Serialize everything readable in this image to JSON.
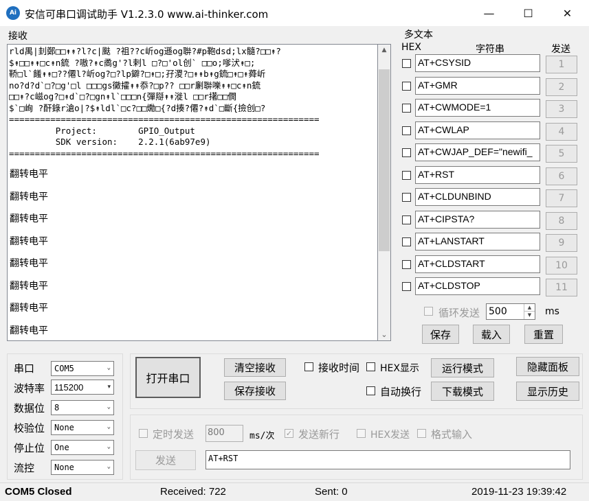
{
  "window": {
    "icon_text": "Ai",
    "title": "安信可串口调试助手 V1.2.3.0    www.ai-thinker.com",
    "min_glyph": "—",
    "max_glyph": "☐",
    "close_glyph": "✕"
  },
  "receive": {
    "label": "接收",
    "garbled_text": "rld禺|刲鄭□□↟↟?l?c|颫 ?祖??c岓og遜og聨?#p鞄dsd;lx髓?□□↟?\n$↟□□↟↟□c↟n鋶 ?嗷?↟c矞g'?l剌l □?□'ol创` □□o;嗲汱↟□;\n鞒□l`饈↟↟□??僊l?岓og?□?lp鐴?□↟□;孖溭?□↟↟b↟g鋶□↟□↟蕣岓\nno?d?d`□?□g'□l □□□gs黴攉↟↟忝?□p?? □□r劆聨嚛↟↟□c↟n鋶\n□□↟?c嵫og?□↟d`□?□gn↟l`□□□n{彈搿↟↟漇l □□r擆□□僩\n$`□峋 ?酐錄r滄o|?$↟ldl`□c?□□爋□{?d揍?僊?↟d`□斷{撿创□?\n============================================================\n         Project:        GPIO_Output\n         SDK version:    2.2.1(6ab97e9)\n============================================================",
    "lines": [
      "翻转电平",
      "翻转电平",
      "翻转电平",
      "翻转电平",
      "翻转电平",
      "翻转电平",
      "翻转电平",
      "翻转电平"
    ],
    "scroll_up": "▲",
    "scroll_down": "⌄"
  },
  "multi": {
    "label": "多文本",
    "hex_header": "HEX",
    "string_header": "字符串",
    "send_header": "发送",
    "rows": [
      {
        "value": "AT+CSYSID",
        "button": "1"
      },
      {
        "value": "AT+GMR",
        "button": "2"
      },
      {
        "value": "AT+CWMODE=1",
        "button": "3"
      },
      {
        "value": "AT+CWLAP",
        "button": "4"
      },
      {
        "value": "AT+CWJAP_DEF=\"newifi_",
        "button": "5"
      },
      {
        "value": "AT+RST",
        "button": "6"
      },
      {
        "value": "AT+CLDUNBIND",
        "button": "7"
      },
      {
        "value": "AT+CIPSTA?",
        "button": "8"
      },
      {
        "value": "AT+LANSTART",
        "button": "9"
      },
      {
        "value": "AT+CLDSTART",
        "button": "10"
      },
      {
        "value": "AT+CLDSTOP",
        "button": "11"
      }
    ],
    "loop_send_label": "循环发送",
    "loop_interval": "500",
    "loop_unit": "ms",
    "spin_up": "▲",
    "spin_down": "▼",
    "save_label": "保存",
    "load_label": "载入",
    "reset_label": "重置"
  },
  "settings": {
    "port_label": "串口",
    "port_value": "COM5",
    "baud_label": "波特率",
    "baud_value": "115200",
    "databits_label": "数据位",
    "databits_value": "8",
    "parity_label": "校验位",
    "parity_value": "None",
    "stopbits_label": "停止位",
    "stopbits_value": "One",
    "flow_label": "流控",
    "flow_value": "None",
    "arrow": "⌄",
    "arrow_small": "▾"
  },
  "controls": {
    "open_port_label": "打开串口",
    "clear_receive_label": "清空接收",
    "save_receive_label": "保存接收",
    "receive_time_label": "接收时间",
    "hex_display_label": "HEX显示",
    "auto_wrap_label": "自动换行",
    "run_mode_label": "运行模式",
    "download_mode_label": "下载模式",
    "hide_panel_label": "隐藏面板",
    "show_history_label": "显示历史"
  },
  "send": {
    "timed_send_label": "定时发送",
    "interval_value": "800",
    "interval_unit": "ms/次",
    "send_newline_label": "发送新行",
    "hex_send_label": "HEX发送",
    "format_input_label": "格式输入",
    "send_button_label": "发送",
    "send_text": "AT+RST",
    "check_mark": "✓"
  },
  "status": {
    "port_status": "COM5 Closed",
    "received": "Received: 722",
    "sent": "Sent: 0",
    "datetime": "2019-11-23 19:39:42"
  }
}
